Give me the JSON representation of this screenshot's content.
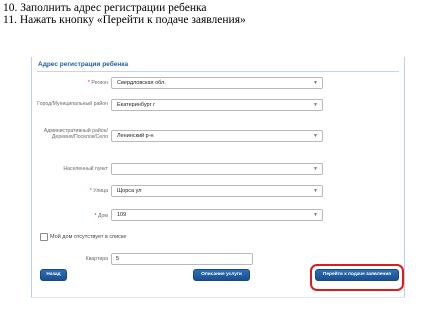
{
  "instructions": [
    "10. Заполнить адрес регистрации ребенка",
    "11. Нажать кнопку «Перейти к подаче заявления»"
  ],
  "form": {
    "section_title": "Адрес регистрации ребенка",
    "region_label": "Регион",
    "region_value": "Свердловская обл.",
    "city_label": "Город/Муниципальный район",
    "city_value": "Екатеринбург г",
    "district_label": "Административный район/Деревня/Поселок/Село",
    "district_value": "Ленинский р-н",
    "settlement_label": "Населенный пункт",
    "settlement_value": "",
    "street_label": "Улица",
    "street_value": "Щорса ул",
    "house_label": "Дом",
    "house_value": "109",
    "checkbox_label": "Мой дом отсутствует в списке",
    "apartment_label": "Квартира",
    "apartment_value": "5"
  },
  "buttons": {
    "back": "Назад",
    "service_description": "Описание услуги",
    "proceed": "Перейти к подаче заявления"
  },
  "icons": {
    "dropdown": "chevron-down-icon"
  },
  "colors": {
    "accent": "#1f5fa8",
    "button": "#1f5a9e",
    "highlight": "#d71d1d",
    "required": "#dd2222"
  }
}
